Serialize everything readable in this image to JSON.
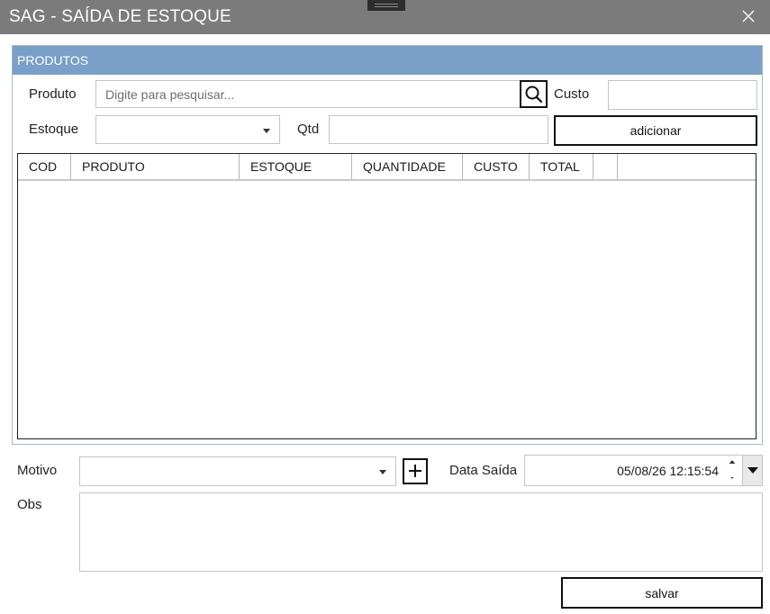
{
  "window": {
    "title": "SAG - SAÍDA DE ESTOQUE",
    "close_icon": "close-icon",
    "drag_icon": "drag-handle-icon"
  },
  "produtos": {
    "header": "PRODUTOS",
    "produto_label": "Produto",
    "produto_placeholder": "Digite para pesquisar...",
    "produto_value": "",
    "search_icon": "search-icon",
    "custo_label": "Custo",
    "custo_value": "",
    "estoque_label": "Estoque",
    "estoque_value": "",
    "qtd_label": "Qtd",
    "qtd_value": "",
    "add_button": "adicionar"
  },
  "grid": {
    "columns": [
      "COD",
      "PRODUTO",
      "ESTOQUE",
      "QUANTIDADE",
      "CUSTO",
      "TOTAL",
      "",
      ""
    ],
    "rows": []
  },
  "footer": {
    "motivo_label": "Motivo",
    "motivo_value": "",
    "add_motivo_icon": "plus-icon",
    "data_saida_label": "Data Saída",
    "data_saida_value": "05/08/26 12:15:54",
    "obs_label": "Obs",
    "obs_value": "",
    "save_button": "salvar"
  },
  "colors": {
    "titlebar": "#7b7b7b",
    "group_header": "#7a9fc9",
    "group_border": "#a9b7c6"
  }
}
